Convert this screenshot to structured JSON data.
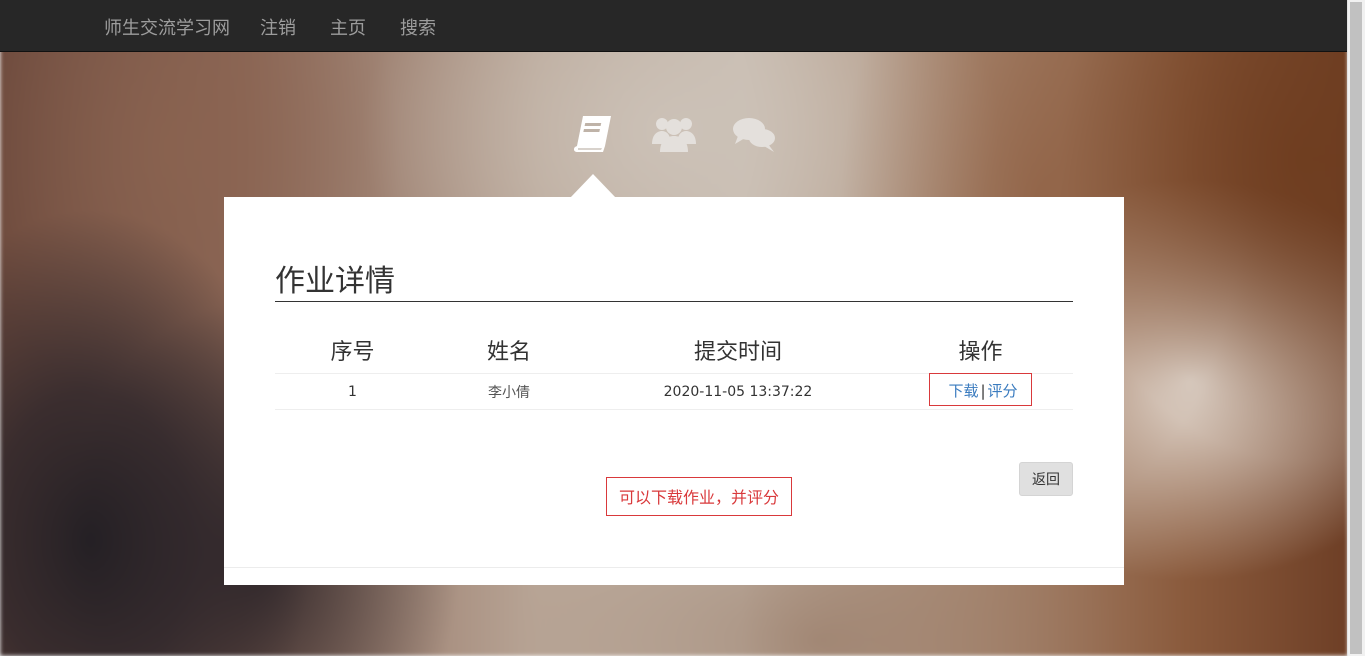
{
  "navbar": {
    "brand": "师生交流学习网",
    "links": [
      "注销",
      "主页",
      "搜索"
    ]
  },
  "icons": {
    "homework": "book-icon",
    "users": "users-icon",
    "chat": "comments-icon"
  },
  "panel": {
    "title": "作业详情",
    "table": {
      "headers": [
        "序号",
        "姓名",
        "提交时间",
        "操作"
      ],
      "rows": [
        {
          "index": "1",
          "name": "李小倩",
          "submit_time": "2020-11-05 13:37:22",
          "actions": {
            "download": "下载",
            "separator": "|",
            "grade": "评分"
          }
        }
      ]
    },
    "back_label": "返回",
    "hint": "可以下载作业，并评分"
  },
  "colors": {
    "navbar_bg": "#272727",
    "nav_text": "#9d9d9d",
    "link": "#3a7bbf",
    "highlight_border": "#d9393b"
  }
}
